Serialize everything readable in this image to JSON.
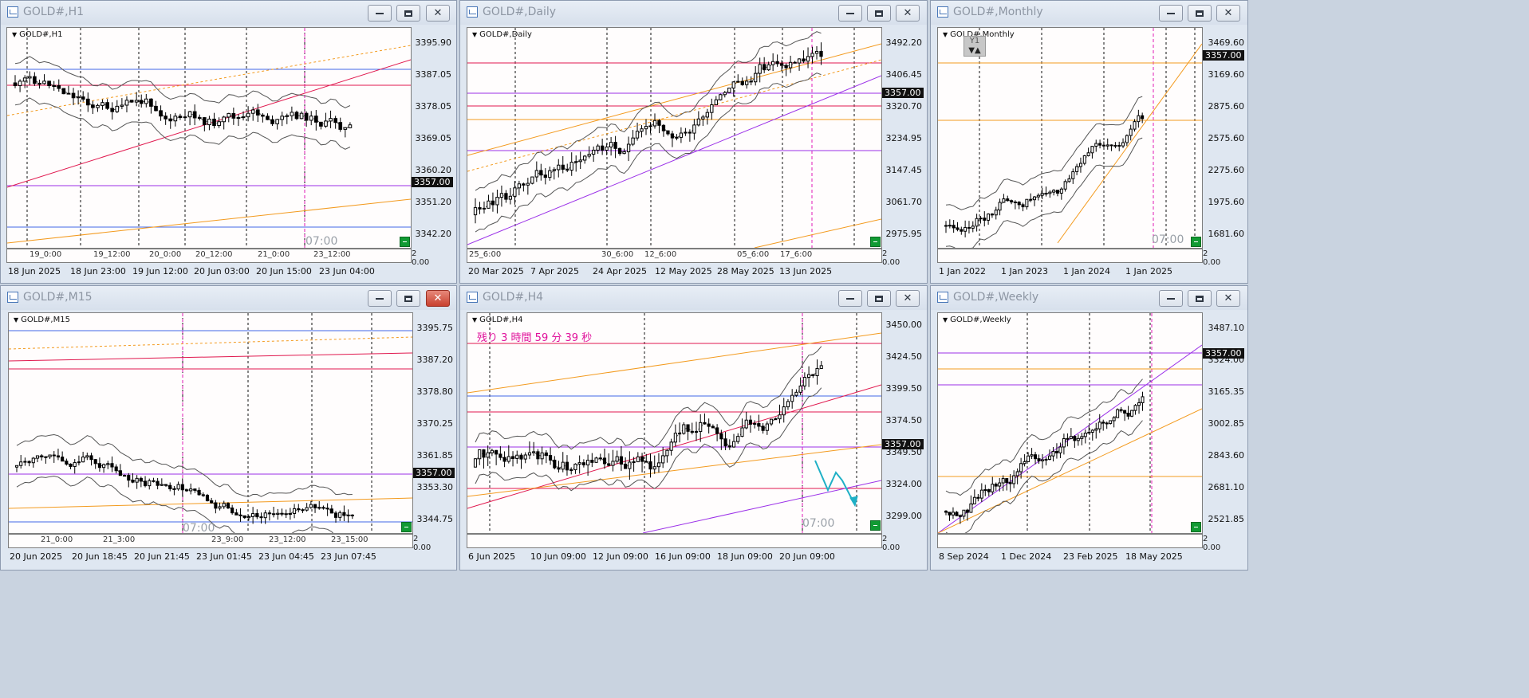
{
  "charts": [
    {
      "title": "GOLD#,H1",
      "label": "GOLD#,H1",
      "price_ticks": [
        "3395.90",
        "3387.05",
        "3378.05",
        "3369.05",
        "3360.20",
        "3351.20",
        "3342.20"
      ],
      "current_price": "3357.00",
      "time_labels": [
        "18 Jun 2025",
        "18 Jun 23:00",
        "19 Jun 12:00",
        "20 Jun 03:00",
        "20 Jun 15:00",
        "23 Jun 04:00"
      ],
      "sub_labels": [
        "19_0:00",
        "19_12:00",
        "20_0:00",
        "20_12:00",
        "21_0:00",
        "23_12:00"
      ],
      "overlay": "07:00",
      "sub_scale": [
        "2",
        "0.00"
      ],
      "close_state": "normal"
    },
    {
      "title": "GOLD#,Daily",
      "label": "GOLD#,Daily",
      "price_ticks": [
        "3492.20",
        "3406.45",
        "3320.70",
        "3234.95",
        "3147.45",
        "3061.70",
        "2975.95"
      ],
      "current_price": "3357.00",
      "time_labels": [
        "20 Mar 2025",
        "7 Apr 2025",
        "24 Apr 2025",
        "12 May 2025",
        "28 May 2025",
        "13 Jun 2025"
      ],
      "sub_labels": [
        "25_6:00",
        "30_6:00",
        "12_6:00",
        "05_6:00",
        "17_6:00"
      ],
      "overlay": "",
      "sub_scale": [
        "2",
        "0.00"
      ],
      "close_state": "normal"
    },
    {
      "title": "GOLD#,Monthly",
      "label": "GOLD#,Monthly",
      "price_ticks": [
        "3469.60",
        "3169.60",
        "2875.60",
        "2575.60",
        "2275.60",
        "1975.60",
        "1681.60"
      ],
      "current_price": "3357.00",
      "time_labels": [
        "1 Jan 2022",
        "1 Jan 2023",
        "1 Jan 2024",
        "1 Jan 2025"
      ],
      "sub_labels": [],
      "overlay": "07:00",
      "y1": "Y1",
      "sub_scale": [
        "2",
        "0.00"
      ],
      "close_state": "normal"
    },
    {
      "title": "GOLD#,M15",
      "label": "GOLD#,M15",
      "price_ticks": [
        "3395.75",
        "3387.20",
        "3378.80",
        "3370.25",
        "3361.85",
        "3353.30",
        "3344.75"
      ],
      "current_price": "3357.00",
      "time_labels": [
        "20 Jun 2025",
        "20 Jun 18:45",
        "20 Jun 21:45",
        "23 Jun 01:45",
        "23 Jun 04:45",
        "23 Jun 07:45"
      ],
      "sub_labels": [
        "21_0:00",
        "21_3:00",
        "23_9:00",
        "23_12:00",
        "23_15:00"
      ],
      "overlay": "07:00",
      "sub_scale": [
        "2",
        "0.00"
      ],
      "close_state": "active"
    },
    {
      "title": "GOLD#,H4",
      "label": "GOLD#,H4",
      "price_ticks": [
        "3450.00",
        "3424.50",
        "3399.50",
        "3374.50",
        "3349.50",
        "3324.00",
        "3299.00"
      ],
      "current_price": "3357.00",
      "time_labels": [
        "6 Jun 2025",
        "10 Jun 09:00",
        "12 Jun 09:00",
        "16 Jun 09:00",
        "18 Jun 09:00",
        "20 Jun 09:00"
      ],
      "sub_labels": [],
      "overlay": "07:00",
      "countdown": "残り 3 時間 59 分 39 秒",
      "sub_scale": [
        "2",
        "0.00"
      ],
      "close_state": "normal"
    },
    {
      "title": "GOLD#,Weekly",
      "label": "GOLD#,Weekly",
      "price_ticks": [
        "3487.10",
        "3324.00",
        "3165.35",
        "3002.85",
        "2843.60",
        "2681.10",
        "2521.85"
      ],
      "current_price": "3357.00",
      "time_labels": [
        "8 Sep 2024",
        "1 Dec 2024",
        "23 Feb 2025",
        "18 May 2025"
      ],
      "sub_labels": [],
      "overlay": "",
      "sub_scale": [
        "2",
        "0.00"
      ],
      "close_state": "normal"
    }
  ],
  "colors": {
    "bull_fill": "#ffffff",
    "bear_fill": "#000000",
    "candle_outline": "#000000",
    "ma_orange": "#f39a1e",
    "red_line": "#e0184e",
    "purple_line": "#9b30e8",
    "blue_line": "#4266e8",
    "magenta_dash": "#e21bb6",
    "bollinger": "#555555",
    "cyan_zigzag": "#1fb0c6"
  }
}
